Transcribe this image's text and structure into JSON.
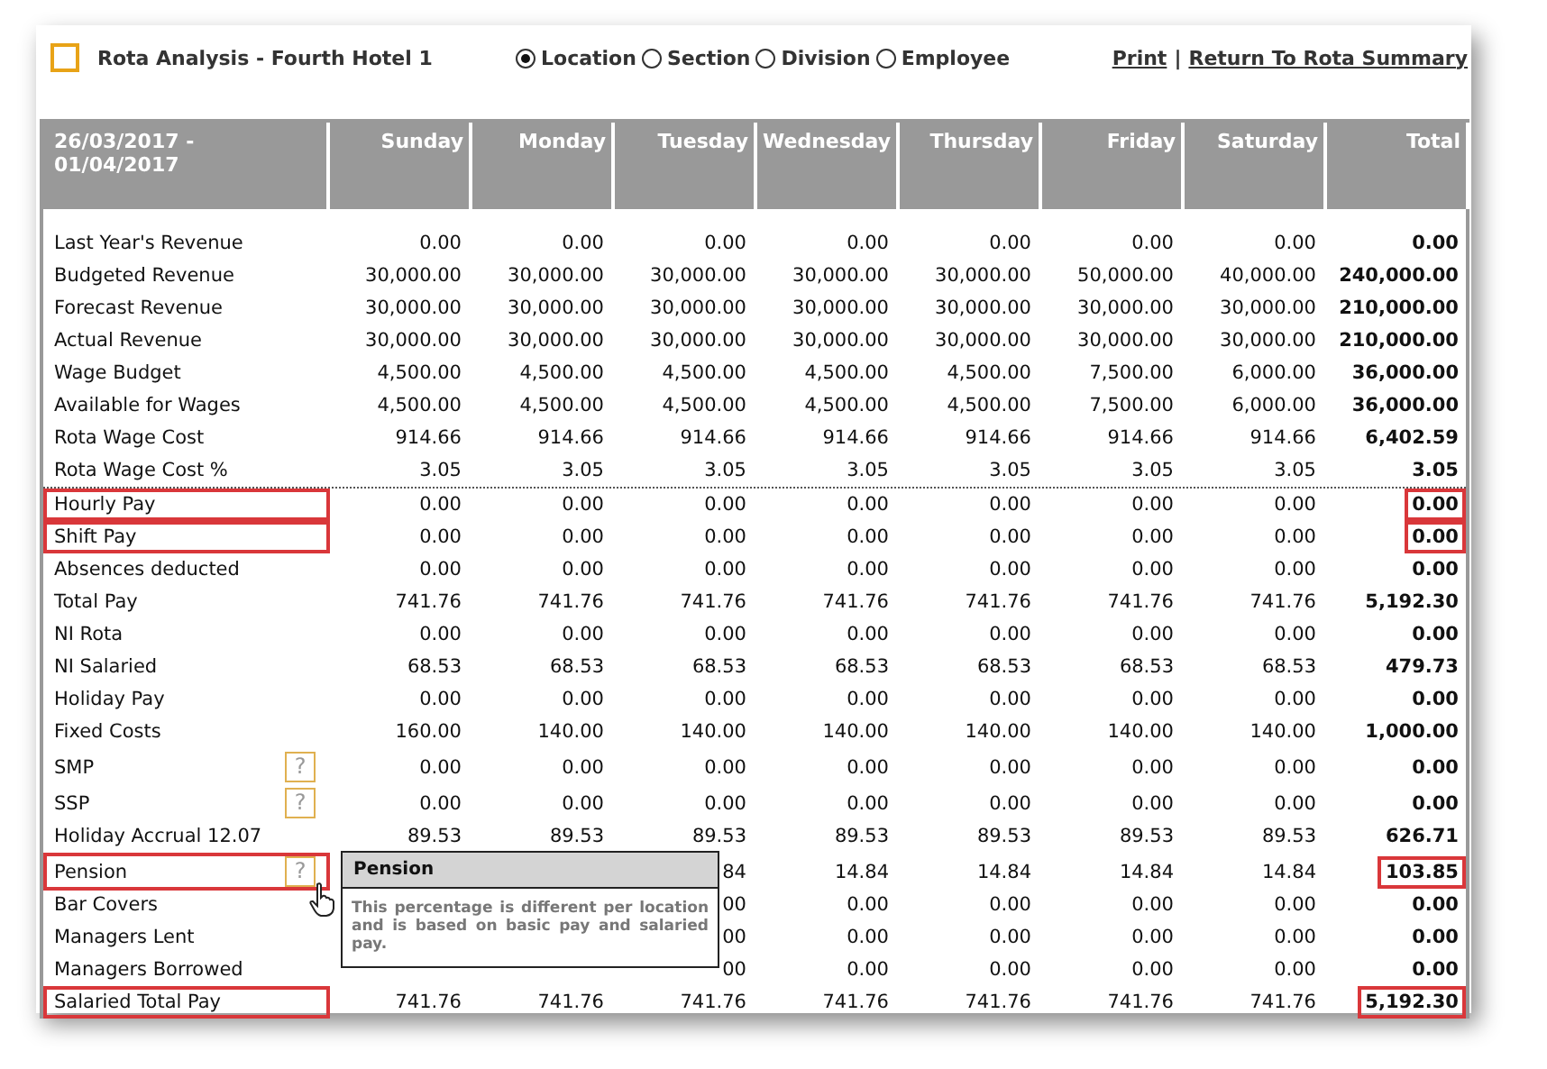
{
  "title": "Rota Analysis - Fourth Hotel 1",
  "view_options": [
    {
      "label": "Location",
      "selected": true
    },
    {
      "label": "Section",
      "selected": false
    },
    {
      "label": "Division",
      "selected": false
    },
    {
      "label": "Employee",
      "selected": false
    }
  ],
  "links": [
    "Print",
    "Return To Rota Summary"
  ],
  "link_separator": "|",
  "table": {
    "columns": [
      "26/03/2017 - 01/04/2017",
      "Sunday",
      "Monday",
      "Tuesday",
      "Wednesday",
      "Thursday",
      "Friday",
      "Saturday",
      "Total"
    ],
    "rows": [
      {
        "label": "Last Year's Revenue",
        "values": [
          "0.00",
          "0.00",
          "0.00",
          "0.00",
          "0.00",
          "0.00",
          "0.00",
          "0.00"
        ],
        "label_highlighted": false,
        "total_highlighted": false,
        "divider_before": false
      },
      {
        "label": "Budgeted Revenue",
        "values": [
          "30,000.00",
          "30,000.00",
          "30,000.00",
          "30,000.00",
          "30,000.00",
          "50,000.00",
          "40,000.00",
          "240,000.00"
        ],
        "label_highlighted": false,
        "total_highlighted": false,
        "divider_before": false
      },
      {
        "label": "Forecast Revenue",
        "values": [
          "30,000.00",
          "30,000.00",
          "30,000.00",
          "30,000.00",
          "30,000.00",
          "30,000.00",
          "30,000.00",
          "210,000.00"
        ],
        "label_highlighted": false,
        "total_highlighted": false,
        "divider_before": false
      },
      {
        "label": "Actual Revenue",
        "values": [
          "30,000.00",
          "30,000.00",
          "30,000.00",
          "30,000.00",
          "30,000.00",
          "30,000.00",
          "30,000.00",
          "210,000.00"
        ],
        "label_highlighted": false,
        "total_highlighted": false,
        "divider_before": false
      },
      {
        "label": "Wage Budget",
        "values": [
          "4,500.00",
          "4,500.00",
          "4,500.00",
          "4,500.00",
          "4,500.00",
          "7,500.00",
          "6,000.00",
          "36,000.00"
        ],
        "label_highlighted": false,
        "total_highlighted": false,
        "divider_before": false
      },
      {
        "label": "Available for Wages",
        "values": [
          "4,500.00",
          "4,500.00",
          "4,500.00",
          "4,500.00",
          "4,500.00",
          "7,500.00",
          "6,000.00",
          "36,000.00"
        ],
        "label_highlighted": false,
        "total_highlighted": false,
        "divider_before": false
      },
      {
        "label": "Rota Wage Cost",
        "values": [
          "914.66",
          "914.66",
          "914.66",
          "914.66",
          "914.66",
          "914.66",
          "914.66",
          "6,402.59"
        ],
        "label_highlighted": false,
        "total_highlighted": false,
        "divider_before": false
      },
      {
        "label": "Rota Wage Cost %",
        "values": [
          "3.05",
          "3.05",
          "3.05",
          "3.05",
          "3.05",
          "3.05",
          "3.05",
          "3.05"
        ],
        "label_highlighted": false,
        "total_highlighted": false,
        "divider_before": false
      },
      {
        "label": "Hourly Pay",
        "values": [
          "0.00",
          "0.00",
          "0.00",
          "0.00",
          "0.00",
          "0.00",
          "0.00",
          "0.00"
        ],
        "label_highlighted": true,
        "total_highlighted": true,
        "divider_before": true
      },
      {
        "label": "Shift Pay",
        "values": [
          "0.00",
          "0.00",
          "0.00",
          "0.00",
          "0.00",
          "0.00",
          "0.00",
          "0.00"
        ],
        "label_highlighted": true,
        "total_highlighted": true,
        "divider_before": false
      },
      {
        "label": "Absences deducted",
        "values": [
          "0.00",
          "0.00",
          "0.00",
          "0.00",
          "0.00",
          "0.00",
          "0.00",
          "0.00"
        ],
        "label_highlighted": false,
        "total_highlighted": false,
        "divider_before": false
      },
      {
        "label": "Total Pay",
        "values": [
          "741.76",
          "741.76",
          "741.76",
          "741.76",
          "741.76",
          "741.76",
          "741.76",
          "5,192.30"
        ],
        "label_highlighted": false,
        "total_highlighted": false,
        "divider_before": false
      },
      {
        "label": "NI Rota",
        "values": [
          "0.00",
          "0.00",
          "0.00",
          "0.00",
          "0.00",
          "0.00",
          "0.00",
          "0.00"
        ],
        "label_highlighted": false,
        "total_highlighted": false,
        "divider_before": false
      },
      {
        "label": "NI Salaried",
        "values": [
          "68.53",
          "68.53",
          "68.53",
          "68.53",
          "68.53",
          "68.53",
          "68.53",
          "479.73"
        ],
        "label_highlighted": false,
        "total_highlighted": false,
        "divider_before": false
      },
      {
        "label": "Holiday Pay",
        "values": [
          "0.00",
          "0.00",
          "0.00",
          "0.00",
          "0.00",
          "0.00",
          "0.00",
          "0.00"
        ],
        "label_highlighted": false,
        "total_highlighted": false,
        "divider_before": false
      },
      {
        "label": "Fixed Costs",
        "values": [
          "160.00",
          "140.00",
          "140.00",
          "140.00",
          "140.00",
          "140.00",
          "140.00",
          "1,000.00"
        ],
        "label_highlighted": false,
        "total_highlighted": false,
        "divider_before": false
      },
      {
        "label": "SMP",
        "help": "?",
        "values": [
          "0.00",
          "0.00",
          "0.00",
          "0.00",
          "0.00",
          "0.00",
          "0.00",
          "0.00"
        ],
        "label_highlighted": false,
        "total_highlighted": false,
        "divider_before": false
      },
      {
        "label": "SSP",
        "help": "?",
        "values": [
          "0.00",
          "0.00",
          "0.00",
          "0.00",
          "0.00",
          "0.00",
          "0.00",
          "0.00"
        ],
        "label_highlighted": false,
        "total_highlighted": false,
        "divider_before": false
      },
      {
        "label": "Holiday Accrual 12.07",
        "values": [
          "89.53",
          "89.53",
          "89.53",
          "89.53",
          "89.53",
          "89.53",
          "89.53",
          "626.71"
        ],
        "label_highlighted": false,
        "total_highlighted": false,
        "divider_before": false
      },
      {
        "label": "Pension",
        "help": "?",
        "values": [
          "84",
          "14.84",
          "14.84",
          "14.84",
          "14.84",
          "103.85"
        ],
        "label_highlighted": true,
        "total_highlighted": true,
        "divider_before": false,
        "tooltip": {
          "title": "Pension",
          "text": "This percentage is different per location and is based on basic pay and salaried pay."
        }
      },
      {
        "label": "Bar Covers",
        "values": [
          "00",
          "0.00",
          "0.00",
          "0.00",
          "0.00",
          "0.00"
        ],
        "label_highlighted": false,
        "total_highlighted": false,
        "divider_before": false
      },
      {
        "label": "Managers Lent",
        "values": [
          "00",
          "0.00",
          "0.00",
          "0.00",
          "0.00",
          "0.00"
        ],
        "label_highlighted": false,
        "total_highlighted": false,
        "divider_before": false
      },
      {
        "label": "Managers Borrowed",
        "values": [
          "00",
          "0.00",
          "0.00",
          "0.00",
          "0.00",
          "0.00"
        ],
        "label_highlighted": false,
        "total_highlighted": false,
        "divider_before": false
      },
      {
        "label": "Salaried Total Pay",
        "values": [
          "741.76",
          "741.76",
          "741.76",
          "741.76",
          "741.76",
          "741.76",
          "741.76",
          "5,192.30"
        ],
        "label_highlighted": true,
        "total_highlighted": true,
        "divider_before": false
      }
    ]
  }
}
